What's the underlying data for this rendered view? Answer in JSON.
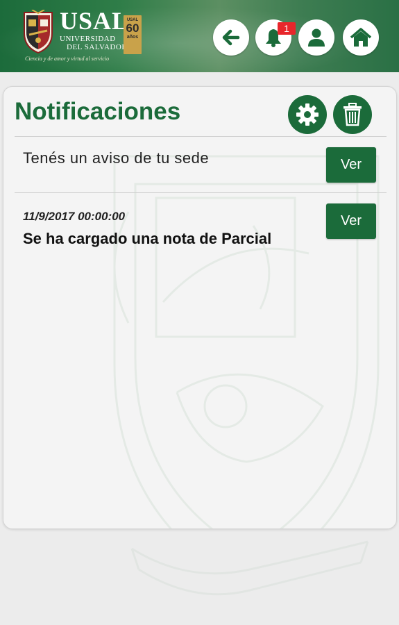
{
  "header": {
    "logo_title": "USAL",
    "logo_line1": "UNIVERSIDAD",
    "logo_line2": "DEL SALVADOR",
    "logo_motto": "Ciencia y de amor y virtud al servicio",
    "badge_small": "USAL",
    "badge_number": "60",
    "badge_suffix": "años",
    "notification_count": "1",
    "icons": [
      "back-arrow-icon",
      "bell-icon",
      "user-icon",
      "home-icon"
    ],
    "brand_color": "#1b6b3a"
  },
  "page": {
    "title": "Notificaciones",
    "icons": [
      "gear-icon",
      "trash-icon"
    ]
  },
  "notifications": [
    {
      "text": "Tenés un aviso de tu sede",
      "button_label": "Ver"
    },
    {
      "date": "11/9/2017 00:00:00",
      "title": "Se ha cargado una nota de Parcial",
      "button_label": "Ver"
    }
  ],
  "colors": {
    "accent": "#1b6b3a",
    "badge_red": "#e8262b",
    "background": "#ececec",
    "card": "#f4f4f4"
  }
}
